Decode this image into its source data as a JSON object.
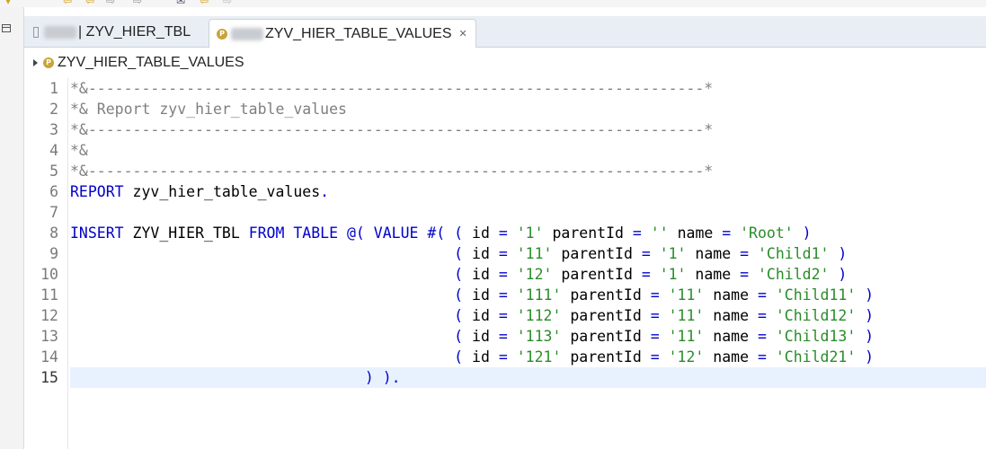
{
  "tabs": [
    {
      "label": "| ZYV_HIER_TBL",
      "active": false
    },
    {
      "label": "ZYV_HIER_TABLE_VALUES",
      "active": true
    }
  ],
  "breadcrumb": {
    "label": "ZYV_HIER_TABLE_VALUES"
  },
  "colors": {
    "keyword": "#0000cc",
    "string": "#2a8c2a",
    "comment": "#7f7f7f",
    "current_line": "#e8f2fe"
  },
  "editor": {
    "current_line": 15,
    "lines": [
      {
        "num": "1",
        "tokens": [
          {
            "c": "c",
            "t": "*&---------------------------------------------------------------------*"
          }
        ]
      },
      {
        "num": "2",
        "tokens": [
          {
            "c": "c",
            "t": "*& Report zyv_hier_table_values"
          }
        ]
      },
      {
        "num": "3",
        "tokens": [
          {
            "c": "c",
            "t": "*&---------------------------------------------------------------------*"
          }
        ]
      },
      {
        "num": "4",
        "tokens": [
          {
            "c": "c",
            "t": "*&"
          }
        ]
      },
      {
        "num": "5",
        "tokens": [
          {
            "c": "c",
            "t": "*&---------------------------------------------------------------------*"
          }
        ]
      },
      {
        "num": "6",
        "tokens": [
          {
            "c": "k",
            "t": "REPORT"
          },
          {
            "c": "t",
            "t": " zyv_hier_table_values"
          },
          {
            "c": "k",
            "t": "."
          }
        ]
      },
      {
        "num": "7",
        "tokens": []
      },
      {
        "num": "8",
        "tokens": [
          {
            "c": "k",
            "t": "INSERT"
          },
          {
            "c": "t",
            "t": " ZYV_HIER_TBL "
          },
          {
            "c": "k",
            "t": "FROM TABLE @( VALUE #( ( "
          },
          {
            "c": "t",
            "t": "id "
          },
          {
            "c": "k",
            "t": "= "
          },
          {
            "c": "s",
            "t": "'1'"
          },
          {
            "c": "t",
            "t": " parentId "
          },
          {
            "c": "k",
            "t": "= "
          },
          {
            "c": "s",
            "t": "''"
          },
          {
            "c": "t",
            "t": " name "
          },
          {
            "c": "k",
            "t": "= "
          },
          {
            "c": "s",
            "t": "'Root'"
          },
          {
            "c": "k",
            "t": " )"
          }
        ]
      },
      {
        "num": "9",
        "tokens": [
          {
            "c": "t",
            "t": "                                           "
          },
          {
            "c": "k",
            "t": "( "
          },
          {
            "c": "t",
            "t": "id "
          },
          {
            "c": "k",
            "t": "= "
          },
          {
            "c": "s",
            "t": "'11'"
          },
          {
            "c": "t",
            "t": " parentId "
          },
          {
            "c": "k",
            "t": "= "
          },
          {
            "c": "s",
            "t": "'1'"
          },
          {
            "c": "t",
            "t": " name "
          },
          {
            "c": "k",
            "t": "= "
          },
          {
            "c": "s",
            "t": "'Child1'"
          },
          {
            "c": "k",
            "t": " )"
          }
        ]
      },
      {
        "num": "10",
        "tokens": [
          {
            "c": "t",
            "t": "                                           "
          },
          {
            "c": "k",
            "t": "( "
          },
          {
            "c": "t",
            "t": "id "
          },
          {
            "c": "k",
            "t": "= "
          },
          {
            "c": "s",
            "t": "'12'"
          },
          {
            "c": "t",
            "t": " parentId "
          },
          {
            "c": "k",
            "t": "= "
          },
          {
            "c": "s",
            "t": "'1'"
          },
          {
            "c": "t",
            "t": " name "
          },
          {
            "c": "k",
            "t": "= "
          },
          {
            "c": "s",
            "t": "'Child2'"
          },
          {
            "c": "k",
            "t": " )"
          }
        ]
      },
      {
        "num": "11",
        "tokens": [
          {
            "c": "t",
            "t": "                                           "
          },
          {
            "c": "k",
            "t": "( "
          },
          {
            "c": "t",
            "t": "id "
          },
          {
            "c": "k",
            "t": "= "
          },
          {
            "c": "s",
            "t": "'111'"
          },
          {
            "c": "t",
            "t": " parentId "
          },
          {
            "c": "k",
            "t": "= "
          },
          {
            "c": "s",
            "t": "'11'"
          },
          {
            "c": "t",
            "t": " name "
          },
          {
            "c": "k",
            "t": "= "
          },
          {
            "c": "s",
            "t": "'Child11'"
          },
          {
            "c": "k",
            "t": " )"
          }
        ]
      },
      {
        "num": "12",
        "tokens": [
          {
            "c": "t",
            "t": "                                           "
          },
          {
            "c": "k",
            "t": "( "
          },
          {
            "c": "t",
            "t": "id "
          },
          {
            "c": "k",
            "t": "= "
          },
          {
            "c": "s",
            "t": "'112'"
          },
          {
            "c": "t",
            "t": " parentId "
          },
          {
            "c": "k",
            "t": "= "
          },
          {
            "c": "s",
            "t": "'11'"
          },
          {
            "c": "t",
            "t": " name "
          },
          {
            "c": "k",
            "t": "= "
          },
          {
            "c": "s",
            "t": "'Child12'"
          },
          {
            "c": "k",
            "t": " )"
          }
        ]
      },
      {
        "num": "13",
        "tokens": [
          {
            "c": "t",
            "t": "                                           "
          },
          {
            "c": "k",
            "t": "( "
          },
          {
            "c": "t",
            "t": "id "
          },
          {
            "c": "k",
            "t": "= "
          },
          {
            "c": "s",
            "t": "'113'"
          },
          {
            "c": "t",
            "t": " parentId "
          },
          {
            "c": "k",
            "t": "= "
          },
          {
            "c": "s",
            "t": "'11'"
          },
          {
            "c": "t",
            "t": " name "
          },
          {
            "c": "k",
            "t": "= "
          },
          {
            "c": "s",
            "t": "'Child13'"
          },
          {
            "c": "k",
            "t": " )"
          }
        ]
      },
      {
        "num": "14",
        "tokens": [
          {
            "c": "t",
            "t": "                                           "
          },
          {
            "c": "k",
            "t": "( "
          },
          {
            "c": "t",
            "t": "id "
          },
          {
            "c": "k",
            "t": "= "
          },
          {
            "c": "s",
            "t": "'121'"
          },
          {
            "c": "t",
            "t": " parentId "
          },
          {
            "c": "k",
            "t": "= "
          },
          {
            "c": "s",
            "t": "'12'"
          },
          {
            "c": "t",
            "t": " name "
          },
          {
            "c": "k",
            "t": "= "
          },
          {
            "c": "s",
            "t": "'Child21'"
          },
          {
            "c": "k",
            "t": " )"
          }
        ]
      },
      {
        "num": "15",
        "tokens": [
          {
            "c": "t",
            "t": "                                 "
          },
          {
            "c": "k",
            "t": ") )."
          }
        ]
      }
    ]
  }
}
